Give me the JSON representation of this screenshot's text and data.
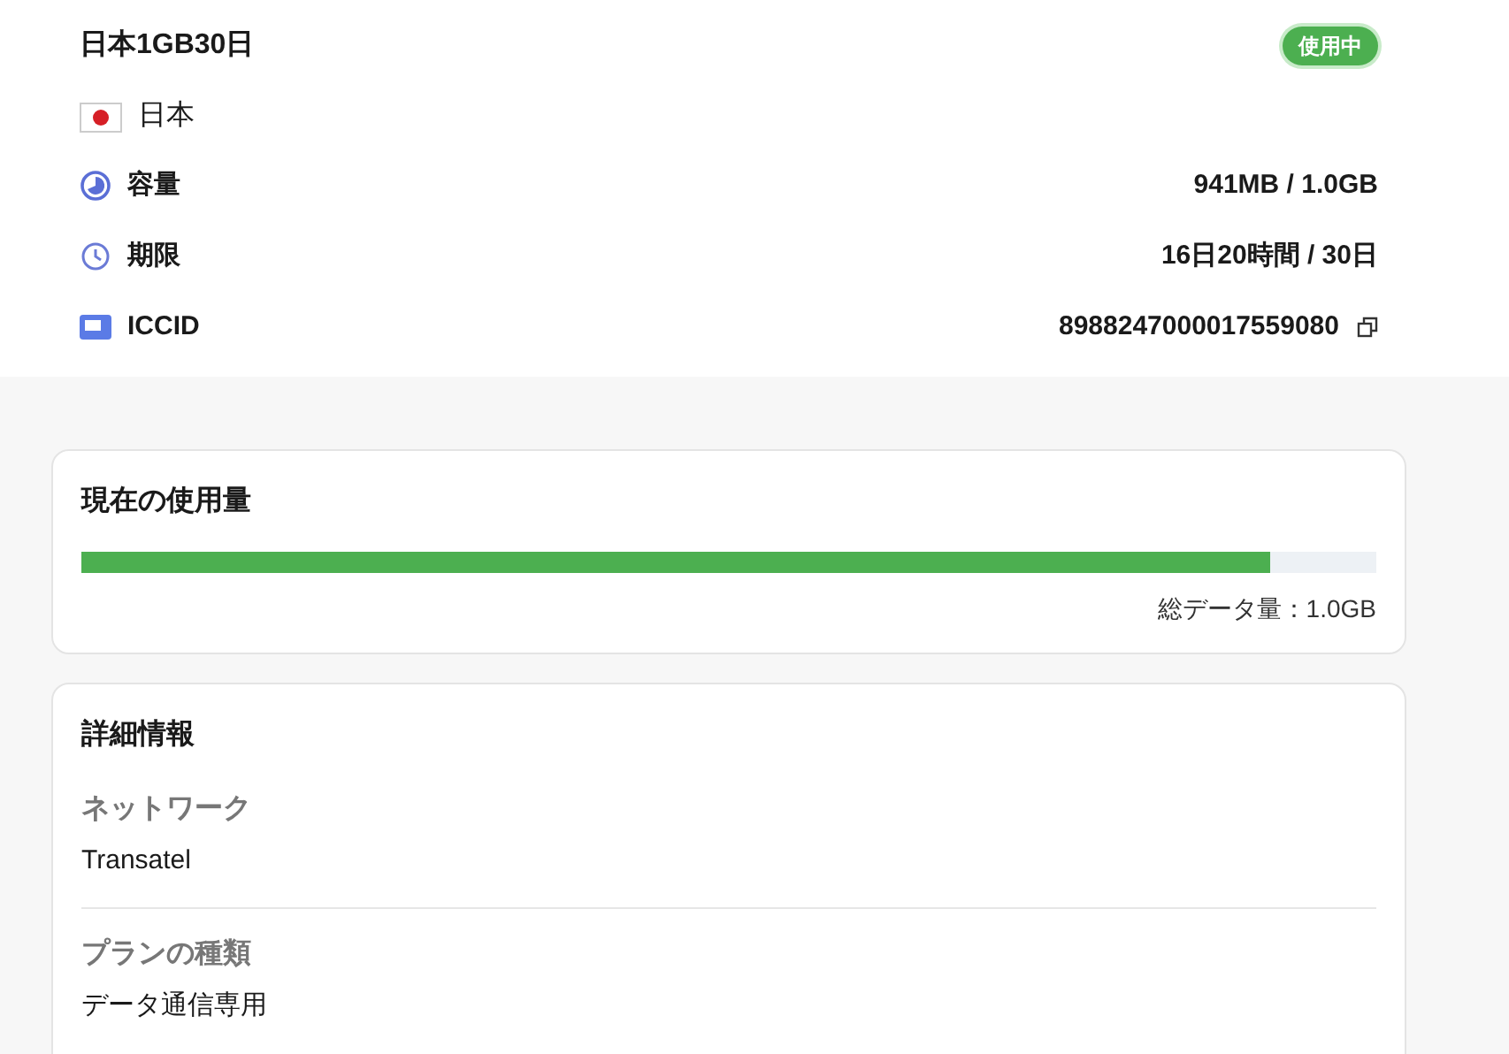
{
  "plan": {
    "title": "日本1GB30日",
    "status": "使用中",
    "country": "日本",
    "rows": [
      {
        "kind": "capacity",
        "label": "容量",
        "value": "941MB / 1.0GB",
        "copyable": false
      },
      {
        "kind": "period",
        "label": "期限",
        "value": "16日20時間 / 30日",
        "copyable": false
      },
      {
        "kind": "sim",
        "label": "ICCID",
        "value": "8988247000017559080",
        "copyable": true
      }
    ]
  },
  "usage": {
    "title": "現在の使用量",
    "level": 0.918,
    "total": "総データ量：1.0GB"
  },
  "details": {
    "title": "詳細情報",
    "items": [
      {
        "label": "ネットワーク",
        "value": "Transatel"
      },
      {
        "label": "プランの種類",
        "value": "データ通信専用"
      }
    ]
  }
}
